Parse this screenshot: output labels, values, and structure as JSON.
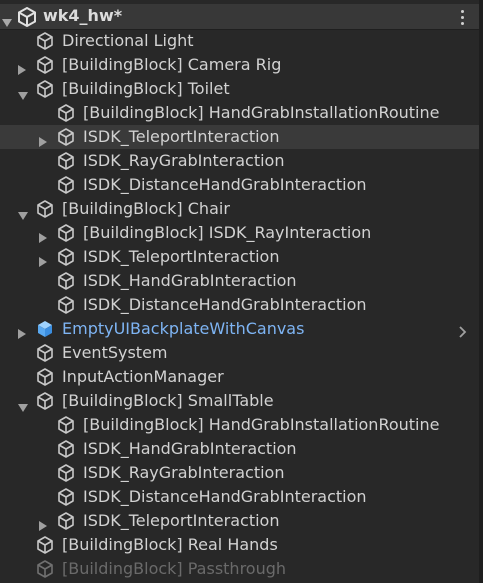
{
  "scene": {
    "title": "wk4_hw*"
  },
  "rows": [
    {
      "label": "Directional Light",
      "depth": 1,
      "arrow": "none"
    },
    {
      "label": "[BuildingBlock] Camera Rig",
      "depth": 1,
      "arrow": "collapsed"
    },
    {
      "label": "[BuildingBlock] Toilet",
      "depth": 1,
      "arrow": "expanded"
    },
    {
      "label": "[BuildingBlock] HandGrabInstallationRoutine",
      "depth": 2,
      "arrow": "none"
    },
    {
      "label": "ISDK_TeleportInteraction",
      "depth": 2,
      "arrow": "collapsed",
      "selected": true
    },
    {
      "label": "ISDK_RayGrabInteraction",
      "depth": 2,
      "arrow": "none"
    },
    {
      "label": "ISDK_DistanceHandGrabInteraction",
      "depth": 2,
      "arrow": "none"
    },
    {
      "label": "[BuildingBlock] Chair",
      "depth": 1,
      "arrow": "expanded"
    },
    {
      "label": "[BuildingBlock] ISDK_RayInteraction",
      "depth": 2,
      "arrow": "collapsed"
    },
    {
      "label": "ISDK_TeleportInteraction",
      "depth": 2,
      "arrow": "collapsed"
    },
    {
      "label": "ISDK_HandGrabInteraction",
      "depth": 2,
      "arrow": "none"
    },
    {
      "label": "ISDK_DistanceHandGrabInteraction",
      "depth": 2,
      "arrow": "none"
    },
    {
      "label": "EmptyUIBackplateWithCanvas",
      "depth": 1,
      "arrow": "collapsed",
      "prefab": true
    },
    {
      "label": "EventSystem",
      "depth": 1,
      "arrow": "none"
    },
    {
      "label": "InputActionManager",
      "depth": 1,
      "arrow": "none"
    },
    {
      "label": "[BuildingBlock] SmallTable",
      "depth": 1,
      "arrow": "expanded"
    },
    {
      "label": "[BuildingBlock] HandGrabInstallationRoutine",
      "depth": 2,
      "arrow": "none"
    },
    {
      "label": "ISDK_HandGrabInteraction",
      "depth": 2,
      "arrow": "none"
    },
    {
      "label": "ISDK_RayGrabInteraction",
      "depth": 2,
      "arrow": "none"
    },
    {
      "label": "ISDK_DistanceHandGrabInteraction",
      "depth": 2,
      "arrow": "none"
    },
    {
      "label": "ISDK_TeleportInteraction",
      "depth": 2,
      "arrow": "collapsed"
    },
    {
      "label": "[BuildingBlock] Real Hands",
      "depth": 1,
      "arrow": "none"
    },
    {
      "label": "[BuildingBlock] Passthrough",
      "depth": 1,
      "arrow": "none",
      "disabled": true
    }
  ],
  "colors": {
    "background": "#282828",
    "text": "#d2d2d2",
    "prefab_text": "#7eb4f3",
    "disabled_text": "#6a6a6a",
    "selected_row": "#3a3a3a"
  },
  "icons": {
    "scene": "unity-logo-icon",
    "gameobject": "cube-outline-icon",
    "prefab": "blue-cube-icon",
    "menu": "kebab-menu-icon"
  }
}
